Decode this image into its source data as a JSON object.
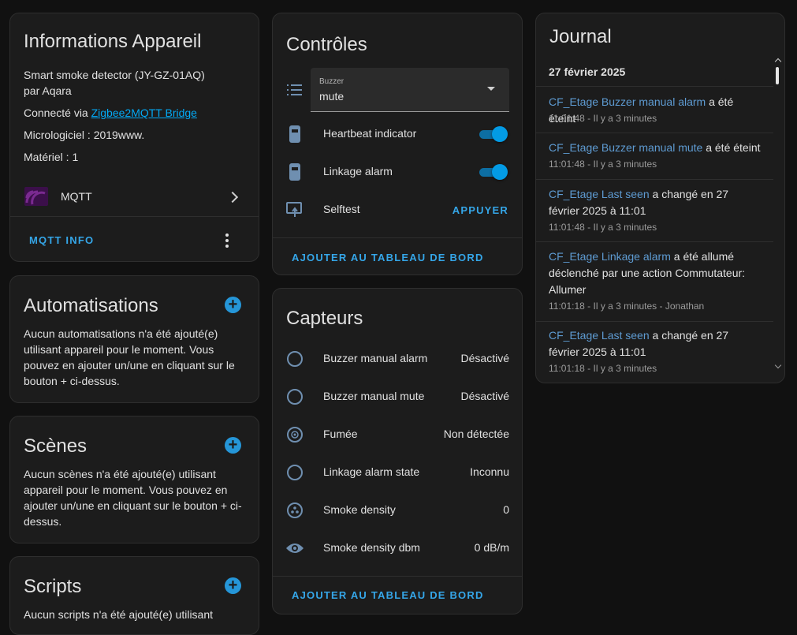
{
  "device_info": {
    "title": "Informations Appareil",
    "model": "Smart smoke detector (JY-GZ-01AQ)",
    "manufacturer": "par Aqara",
    "connected_prefix": "Connecté via ",
    "connected_link": "Zigbee2MQTT Bridge",
    "firmware": "Micrologiciel : 2019www.",
    "hardware": "Matériel : 1",
    "integration": "MQTT",
    "action": "MQTT INFO"
  },
  "automations": {
    "title": "Automatisations",
    "description": "Aucun automatisations n'a été ajouté(e) utilisant appareil pour le moment. Vous pouvez en ajouter un/une en cliquant sur le bouton + ci-dessus."
  },
  "scenes": {
    "title": "Scènes",
    "description": "Aucun scènes n'a été ajouté(e) utilisant appareil pour le moment. Vous pouvez en ajouter un/une en cliquant sur le bouton + ci-dessus."
  },
  "scripts": {
    "title": "Scripts",
    "description": "Aucun scripts n'a été ajouté(e) utilisant"
  },
  "controls": {
    "title": "Contrôles",
    "buzzer_label": "Buzzer",
    "buzzer_value": "mute",
    "heartbeat": "Heartbeat indicator",
    "heartbeat_on": true,
    "linkage": "Linkage alarm",
    "linkage_on": true,
    "selftest": "Selftest",
    "selftest_action": "APPUYER",
    "add_dashboard": "AJOUTER AU TABLEAU DE BORD"
  },
  "sensors": {
    "title": "Capteurs",
    "rows": [
      {
        "label": "Buzzer manual alarm",
        "value": "Désactivé"
      },
      {
        "label": "Buzzer manual mute",
        "value": "Désactivé"
      },
      {
        "label": "Fumée",
        "value": "Non détectée"
      },
      {
        "label": "Linkage alarm state",
        "value": "Inconnu"
      },
      {
        "label": "Smoke density",
        "value": "0"
      },
      {
        "label": "Smoke density dbm",
        "value": "0 dB/m"
      }
    ],
    "add_dashboard": "AJOUTER AU TABLEAU DE BORD"
  },
  "journal": {
    "title": "Journal",
    "date": "27 février 2025",
    "entries": [
      {
        "entity": "CF_Etage Buzzer manual alarm",
        "text": " a été éteint",
        "time": "11:01:48 - Il y a 3 minutes"
      },
      {
        "entity": "CF_Etage Buzzer manual mute",
        "text": " a été éteint",
        "time": "11:01:48 - Il y a 3 minutes"
      },
      {
        "entity": "CF_Etage Last seen",
        "text": " a changé en 27 février 2025 à 11:01",
        "time": "11:01:48 - Il y a 3 minutes"
      },
      {
        "entity": "CF_Etage Linkage alarm",
        "text": " a été allumé déclenché par une action Commutateur: Allumer",
        "time": "11:01:18 - Il y a 3 minutes - Jonathan"
      },
      {
        "entity": "CF_Etage Last seen",
        "text": " a changé en 27 février 2025 à 11:01",
        "time": "11:01:18 - Il y a 3 minutes"
      }
    ]
  },
  "colors": {
    "accent": "#03a9f4",
    "entity_link": "#5e9bd2",
    "card_bg": "#1c1c1c",
    "page_bg": "#111111"
  }
}
